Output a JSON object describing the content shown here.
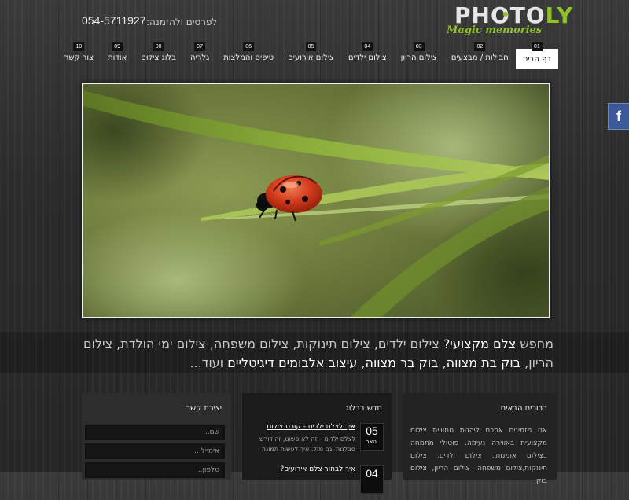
{
  "header": {
    "phone": "054-5711927",
    "phone_label": "לפרטים ולהזמנה:",
    "logo": {
      "main": "PHOTO",
      "accent": "LY",
      "tagline": "Magic memories"
    }
  },
  "nav": [
    {
      "num": "01",
      "label": "דף הבית",
      "active": true
    },
    {
      "num": "02",
      "label": "חבילות / מבצעים"
    },
    {
      "num": "03",
      "label": "צילום הריון"
    },
    {
      "num": "04",
      "label": "צילום ילדים"
    },
    {
      "num": "05",
      "label": "צילום אירועים"
    },
    {
      "num": "06",
      "label": "טיפים והמלצות"
    },
    {
      "num": "07",
      "label": "גלריה"
    },
    {
      "num": "08",
      "label": "בלוג צילום"
    },
    {
      "num": "09",
      "label": "אודות"
    },
    {
      "num": "10",
      "label": "צור קשר"
    }
  ],
  "hero": {
    "icon": "ladybug-photo"
  },
  "social": {
    "facebook": "f"
  },
  "tagline": {
    "p1": "מחפש ",
    "p2": "צלם מקצועי?",
    "p3": " צילום ילדים, צילום תינוקות, צילום משפחה, צילום ימי הולדת, צילום הריון, ",
    "p4": "בוק בת מצווה",
    "p5": ", ",
    "p6": "בוק בר מצווה",
    "p7": ", ",
    "p8": "עיצוב אלבומים דיגיטליים",
    "p9": " ועוד..."
  },
  "contact": {
    "title": "יצירת קשר",
    "name_placeholder": "שם...",
    "email_placeholder": "אימייל...",
    "phone_placeholder": "טלפון..."
  },
  "blog": {
    "title": "חדש בבלוג",
    "posts": [
      {
        "day": "05",
        "month": "ינואר",
        "title": "איך לצלם ילדים - קורס צילום",
        "excerpt": "לצלם ילדים – זה לא פשוט, זה דורש סבלנות וגם מזל. איך לעשות תמונה"
      },
      {
        "day": "04",
        "month": "",
        "title": "איך לבחור צלם אירועים?",
        "excerpt": ""
      }
    ]
  },
  "next": {
    "title": "ברוכים הבאים",
    "text": "אנו מזמינים אתכם ליהנות מחוויית צילום מקצועית באווירה נעימה. פוטולי מתמחה בצילום אומנותי, צילום ילדים, צילום תינוקות,צילום משפחה, צילום הריון, צילום בוק"
  }
}
